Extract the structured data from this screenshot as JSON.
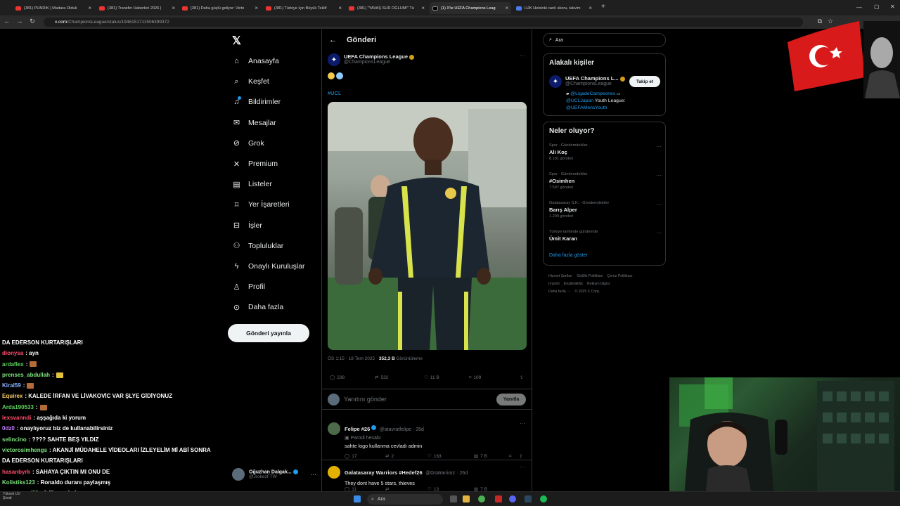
{
  "browser": {
    "tabs": [
      {
        "title": "(381) PUNDİK | Madara Olduk",
        "fav": "yt"
      },
      {
        "title": "(381) Transfer Haberleri 2026 |",
        "fav": "yt"
      },
      {
        "title": "(381) Daha güçlü geliyor: Victo",
        "fav": "yt"
      },
      {
        "title": "(381) Türkiye İçin Büyük Teklif",
        "fav": "yt"
      },
      {
        "title": "(381) \"YAVAŞ SÜR OĞLUM!\" Tü",
        "fav": "yt"
      },
      {
        "title": "(1) X'te UEFA Champions Leag",
        "fav": "x"
      },
      {
        "title": "HJK Helsinki canlı skoru, takvim",
        "fav": "web"
      }
    ],
    "url_host": "x.com",
    "url_path": "/ChampionsLeague/status/1946151711506399372"
  },
  "nav": {
    "items": [
      {
        "label": "Anasayfa",
        "icon": "home-icon",
        "glyph": "⌂"
      },
      {
        "label": "Keşfet",
        "icon": "search-icon",
        "glyph": "⌕"
      },
      {
        "label": "Bildirimler",
        "icon": "bell-icon",
        "glyph": "♫"
      },
      {
        "label": "Mesajlar",
        "icon": "mail-icon",
        "glyph": "✉"
      },
      {
        "label": "Grok",
        "icon": "grok-icon",
        "glyph": "⊘"
      },
      {
        "label": "Premium",
        "icon": "x-premium-icon",
        "glyph": "✕"
      },
      {
        "label": "Listeler",
        "icon": "list-icon",
        "glyph": "▤"
      },
      {
        "label": "Yer İşaretleri",
        "icon": "bookmark-icon",
        "glyph": "⌑"
      },
      {
        "label": "İşler",
        "icon": "briefcase-icon",
        "glyph": "⊟"
      },
      {
        "label": "Topluluklar",
        "icon": "communities-icon",
        "glyph": "⚇"
      },
      {
        "label": "Onaylı Kuruluşlar",
        "icon": "lightning-icon",
        "glyph": "ϟ"
      },
      {
        "label": "Profil",
        "icon": "person-icon",
        "glyph": "♙"
      },
      {
        "label": "Daha fazla",
        "icon": "more-circle-icon",
        "glyph": "⊙"
      }
    ],
    "post_button": "Gönderi yayınla",
    "account_name": "Oğuzhan Dalgak...",
    "account_handle": "@JrokezFTW"
  },
  "post": {
    "header": "Gönderi",
    "author_name": "UEFA Champions League",
    "author_handle": "@ChampionsLeague",
    "hashtag": "#UCL",
    "time": "ÖS 1:15 · 18 Tem 2025 · ",
    "views": "352,3 B",
    "views_label": " Görüntüleme",
    "replies": "238",
    "reposts": "532",
    "likes": "11 B",
    "bookmarks": "109",
    "reply_placeholder": "Yanıtını gönder",
    "reply_button": "Yanıtla"
  },
  "replies": [
    {
      "name": "Felipe #26",
      "handle": "@atavratfelipe · 35d",
      "label": "Parodi hesabı",
      "text": "sahte logo kullanma cevladı admin",
      "replies": "17",
      "reposts": "2",
      "likes": "163",
      "views": "7 B"
    },
    {
      "name": "Galatasaray Warriors #Hedef26",
      "handle": "@GsWarriorz · 26d",
      "text": "They dont have 5 stars, thieves",
      "replies": "11",
      "reposts": "",
      "likes": "13",
      "views": "7 B"
    }
  ],
  "right": {
    "search_placeholder": "Ara",
    "related_title": "Alakalı kişiler",
    "related_name": "UEFA Champions L...",
    "related_handle": "@ChampionsLeague",
    "related_bio1": "@LigadeCampeones",
    "related_bio2": "@UCLJapan",
    "related_bio2b": " Youth League:",
    "related_bio3": "@UEFAMensYouth",
    "follow_label": "Takip et",
    "trends_title": "Neler oluyor?",
    "trends": [
      {
        "context": "Spor · Gündemdekiler",
        "name": "Ali Koç",
        "count": "8.191 gönderi"
      },
      {
        "context": "Spor · Gündemdekiler",
        "name": "#Osimhen",
        "count": "7.597 gönderi"
      },
      {
        "context": "Galatasaray S.K. · Gündemdekiler",
        "name": "Barış Alper",
        "count": "1.299 gönderi"
      },
      {
        "context": "Türkiye tarihinde gündemde",
        "name": "Ümit Karan",
        "count": ""
      }
    ],
    "show_more": "Daha fazla göster",
    "footer": [
      "Hizmet Şartları",
      "Gizlilik Politikası",
      "Çerez Politikası",
      "Imprint",
      "Erişilebilirlik",
      "Reklam bilgisi",
      "Daha fazla ···",
      "© 2025 X Corp."
    ]
  },
  "chat": [
    {
      "user": "DA EDERSON KURTARIŞLARI",
      "text": "",
      "color": "#ffffff",
      "emote": false,
      "nouser": true
    },
    {
      "user": "dionysa",
      "text": ": ayn",
      "color": "#ff4d6a",
      "emote": false
    },
    {
      "user": "ardaflex",
      "text": ":",
      "color": "#5fd35f",
      "emote": true
    },
    {
      "user": "prenses_abdullah",
      "text": ":",
      "color": "#7de37d",
      "emote": true
    },
    {
      "user": "Kiral59",
      "text": ":",
      "color": "#8ab4ff",
      "emote": true
    },
    {
      "user": "Equirex",
      "text": ": KALEDE İRFAN VE LİVAKOVİC VAR ŞLYE GİDİYONUZ",
      "color": "#ffd36b",
      "emote": false
    },
    {
      "user": "Arda190533",
      "text": ":",
      "color": "#5fd35f",
      "emote": true
    },
    {
      "user": "lexsvanndi",
      "text": ": aşşağıda ki yorum",
      "color": "#ff4d6a",
      "emote": false
    },
    {
      "user": "0dz0",
      "text": ": onaylıyoruz biz de kullanabilirsiniz",
      "color": "#c77dff",
      "emote": false
    },
    {
      "user": "selincino",
      "text": ": ???? SAHTE BEŞ YILDIZ",
      "color": "#7de37d",
      "emote": false
    },
    {
      "user": "victorosimhengs",
      "text": ": AKANJİ MÜDAHELE VİDEOLARI İZLEYELİM Mİ ABİ SONRA",
      "color": "#7de37d",
      "emote": false
    },
    {
      "user": "DA EDERSON KURTARIŞLARI",
      "text": "",
      "color": "#ffffff",
      "emote": false,
      "nouser": true
    },
    {
      "user": "hasanbyrk",
      "text": ": SAHAYA ÇIKTIN MI ONU DE",
      "color": "#ff4d6a",
      "emote": false
    },
    {
      "user": "Kolistiks123",
      "text": ": Ronaldo duranı paylaşmış",
      "color": "#7de37d",
      "emote": false
    },
    {
      "user": "ernestmuci23",
      "text": ": fellipeye bak aq",
      "color": "#5fd35f",
      "emote": false
    }
  ],
  "taskbar": {
    "search": "Ara",
    "weather_temp": "Yüksek UV",
    "weather_sub": "Şimdi"
  }
}
